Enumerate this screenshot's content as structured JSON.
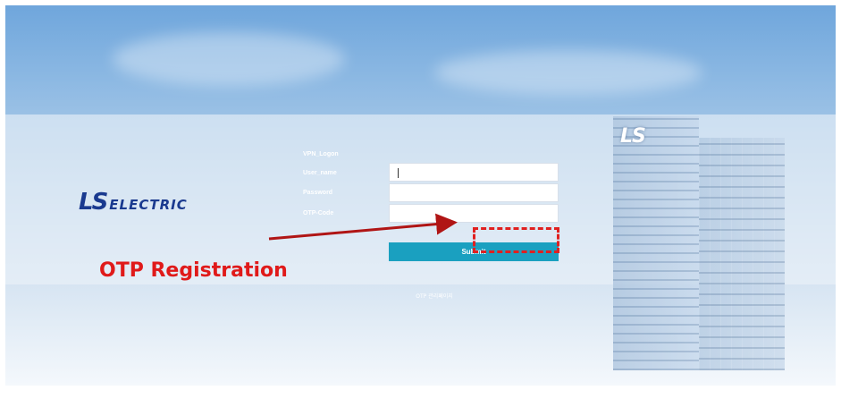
{
  "brand": {
    "mark": "LS",
    "word": "ELECTRIC",
    "building_sign": "LS"
  },
  "login": {
    "title": "VPN_Logon",
    "username_label": "User_name",
    "password_label": "Password",
    "otp_label": "OTP-Code",
    "username_value": "",
    "password_value": "",
    "otp_value": "",
    "submit_label": "Submit",
    "otp_manage_link": "OTP 관리페이지"
  },
  "annotation": {
    "text": "OTP Registration",
    "color": "#e01a1a"
  },
  "colors": {
    "submit": "#1aa0c0",
    "logo": "#1a3a8f"
  }
}
